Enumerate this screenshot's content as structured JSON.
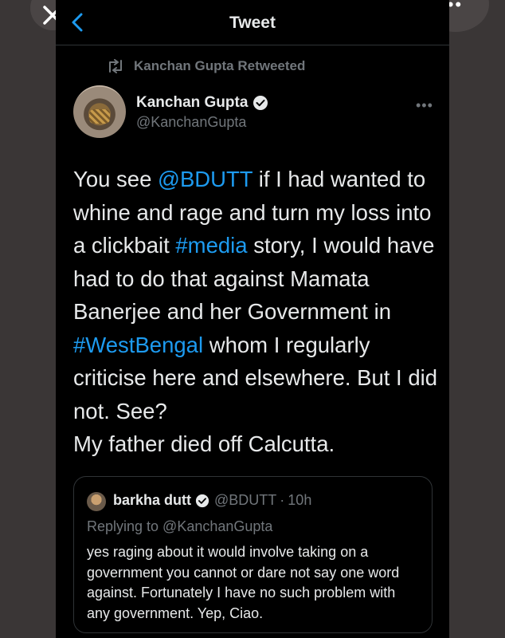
{
  "header": {
    "title": "Tweet"
  },
  "retweet": {
    "label": "Kanchan Gupta Retweeted"
  },
  "author": {
    "name": "Kanchan Gupta",
    "handle": "@KanchanGupta"
  },
  "tweet": {
    "segments": [
      {
        "text": "You see ",
        "link": false
      },
      {
        "text": "@BDUTT",
        "link": true
      },
      {
        "text": " if I had wanted to whine and rage and turn my loss into a clickbait ",
        "link": false
      },
      {
        "text": "#media",
        "link": true
      },
      {
        "text": " story, I would have had to do that against Mamata Banerjee and her Government in ",
        "link": false
      },
      {
        "text": "#WestBengal",
        "link": true
      },
      {
        "text": " whom I regularly criticise here and elsewhere. But I did not. See?",
        "link": false
      },
      {
        "text": "\nMy father died off Calcutta.",
        "link": false
      }
    ]
  },
  "quote": {
    "name": "barkha dutt",
    "handle": "@BDUTT",
    "separator": "·",
    "time": "10h",
    "reply_to": "Replying to @KanchanGupta",
    "text": "yes raging about it would involve taking on a government you cannot or dare not say one word against. Fortunately I have no such problem with any government. Yep, Ciao."
  },
  "colors": {
    "link": "#1d9bf0",
    "text": "#e7e9ea",
    "muted": "#71767b",
    "background": "#000000"
  },
  "icons": [
    "close-icon",
    "more-icon",
    "back-icon",
    "retweet-icon",
    "verified-icon",
    "caret-icon"
  ]
}
